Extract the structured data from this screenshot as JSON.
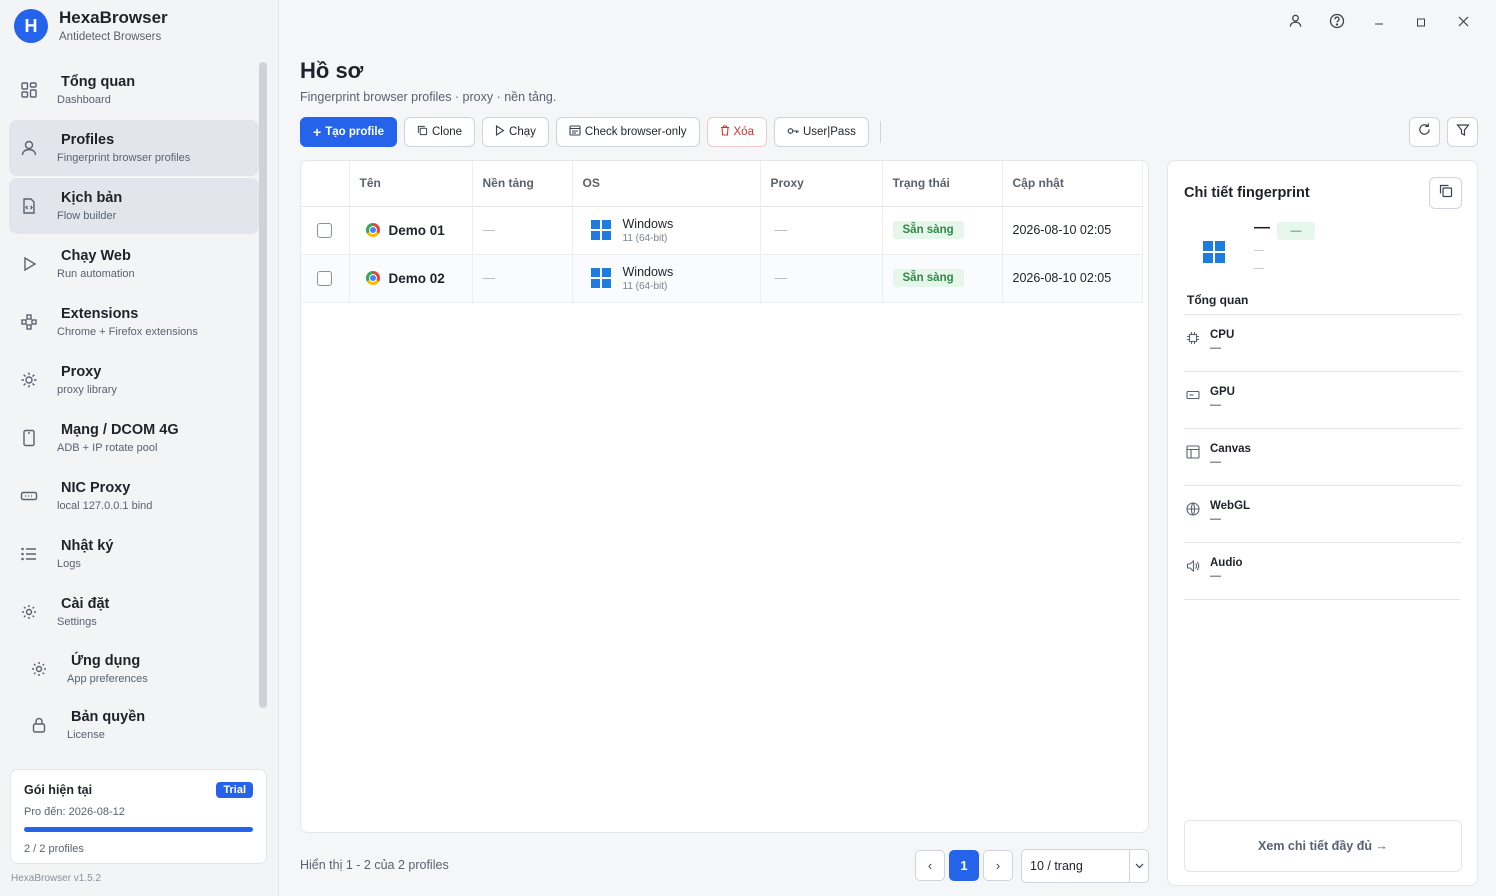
{
  "brand": {
    "name": "HexaBrowser",
    "subtitle": "Antidetect Browsers",
    "logo_letter": "H"
  },
  "sidebar": {
    "items": [
      {
        "title": "Tổng quan",
        "subtitle": "Dashboard",
        "icon": "dashboard-icon"
      },
      {
        "title": "Profiles",
        "subtitle": "Fingerprint browser profiles",
        "icon": "user-icon"
      },
      {
        "title": "Kịch bản",
        "subtitle": "Flow builder",
        "icon": "script-icon"
      },
      {
        "title": "Chạy Web",
        "subtitle": "Run automation",
        "icon": "play-icon"
      },
      {
        "title": "Extensions",
        "subtitle": "Chrome + Firefox extensions",
        "icon": "puzzle-icon"
      },
      {
        "title": "Proxy",
        "subtitle": "proxy library",
        "icon": "sun-icon"
      },
      {
        "title": "Mạng / DCOM 4G",
        "subtitle": "ADB + IP rotate pool",
        "icon": "phone-icon"
      },
      {
        "title": "NIC Proxy",
        "subtitle": "local 127.0.0.1 bind",
        "icon": "nic-icon"
      },
      {
        "title": "Nhật ký",
        "subtitle": "Logs",
        "icon": "list-icon"
      },
      {
        "title": "Cài đặt",
        "subtitle": "Settings",
        "icon": "gear-icon"
      },
      {
        "title": "Ứng dụng",
        "subtitle": "App preferences",
        "icon": "gear-icon"
      },
      {
        "title": "Bản quyền",
        "subtitle": "License",
        "icon": "lock-icon"
      }
    ],
    "plan": {
      "title": "Gói hiện tại",
      "badge": "Trial",
      "expiry": "Pro đến: 2026-08-12",
      "usage": "2 / 2 profiles",
      "usage_fraction": 1.0
    },
    "version": "HexaBrowser v1.5.2"
  },
  "page": {
    "title": "Hồ sơ",
    "subtitle": "Fingerprint browser profiles · proxy · nền tảng."
  },
  "toolbar": {
    "create": "Tạo profile",
    "clone": "Clone",
    "run": "Chạy",
    "check": "Check browser-only",
    "delete": "Xóa",
    "userpass": "User|Pass"
  },
  "table": {
    "columns": [
      "Tên",
      "Nền tảng",
      "OS",
      "Proxy",
      "Trạng thái",
      "Cập nhật"
    ],
    "rows": [
      {
        "name": "Demo 01",
        "platform": "—",
        "os_name": "Windows",
        "os_version": "11 (64-bit)",
        "proxy": "—",
        "status": "Sẵn sàng",
        "updated": "2026-08-10 02:05"
      },
      {
        "name": "Demo 02",
        "platform": "—",
        "os_name": "Windows",
        "os_version": "11 (64-bit)",
        "proxy": "—",
        "status": "Sẵn sàng",
        "updated": "2026-08-10 02:05"
      }
    ]
  },
  "footer": {
    "summary": "Hiển thị 1 - 2 của 2 profiles",
    "prev": "‹",
    "page": "1",
    "next": "›",
    "per_page": "10 / trang"
  },
  "detail": {
    "title": "Chi tiết fingerprint",
    "name": "—",
    "badge": "—",
    "line1": "—",
    "line2": "—",
    "overview": "Tổng quan",
    "rows": [
      {
        "label": "CPU",
        "value": "—",
        "icon": "cpu-icon"
      },
      {
        "label": "GPU",
        "value": "—",
        "icon": "gpu-icon"
      },
      {
        "label": "Canvas",
        "value": "—",
        "icon": "canvas-icon"
      },
      {
        "label": "WebGL",
        "value": "—",
        "icon": "globe-icon"
      },
      {
        "label": "Audio",
        "value": "—",
        "icon": "speaker-icon"
      }
    ],
    "full_button": "Xem chi tiết đầy đủ →"
  },
  "colors": {
    "accent": "#2563eb",
    "success_bg": "#e6f6ea",
    "success_text": "#2f8a46",
    "danger": "#d32f2f"
  }
}
